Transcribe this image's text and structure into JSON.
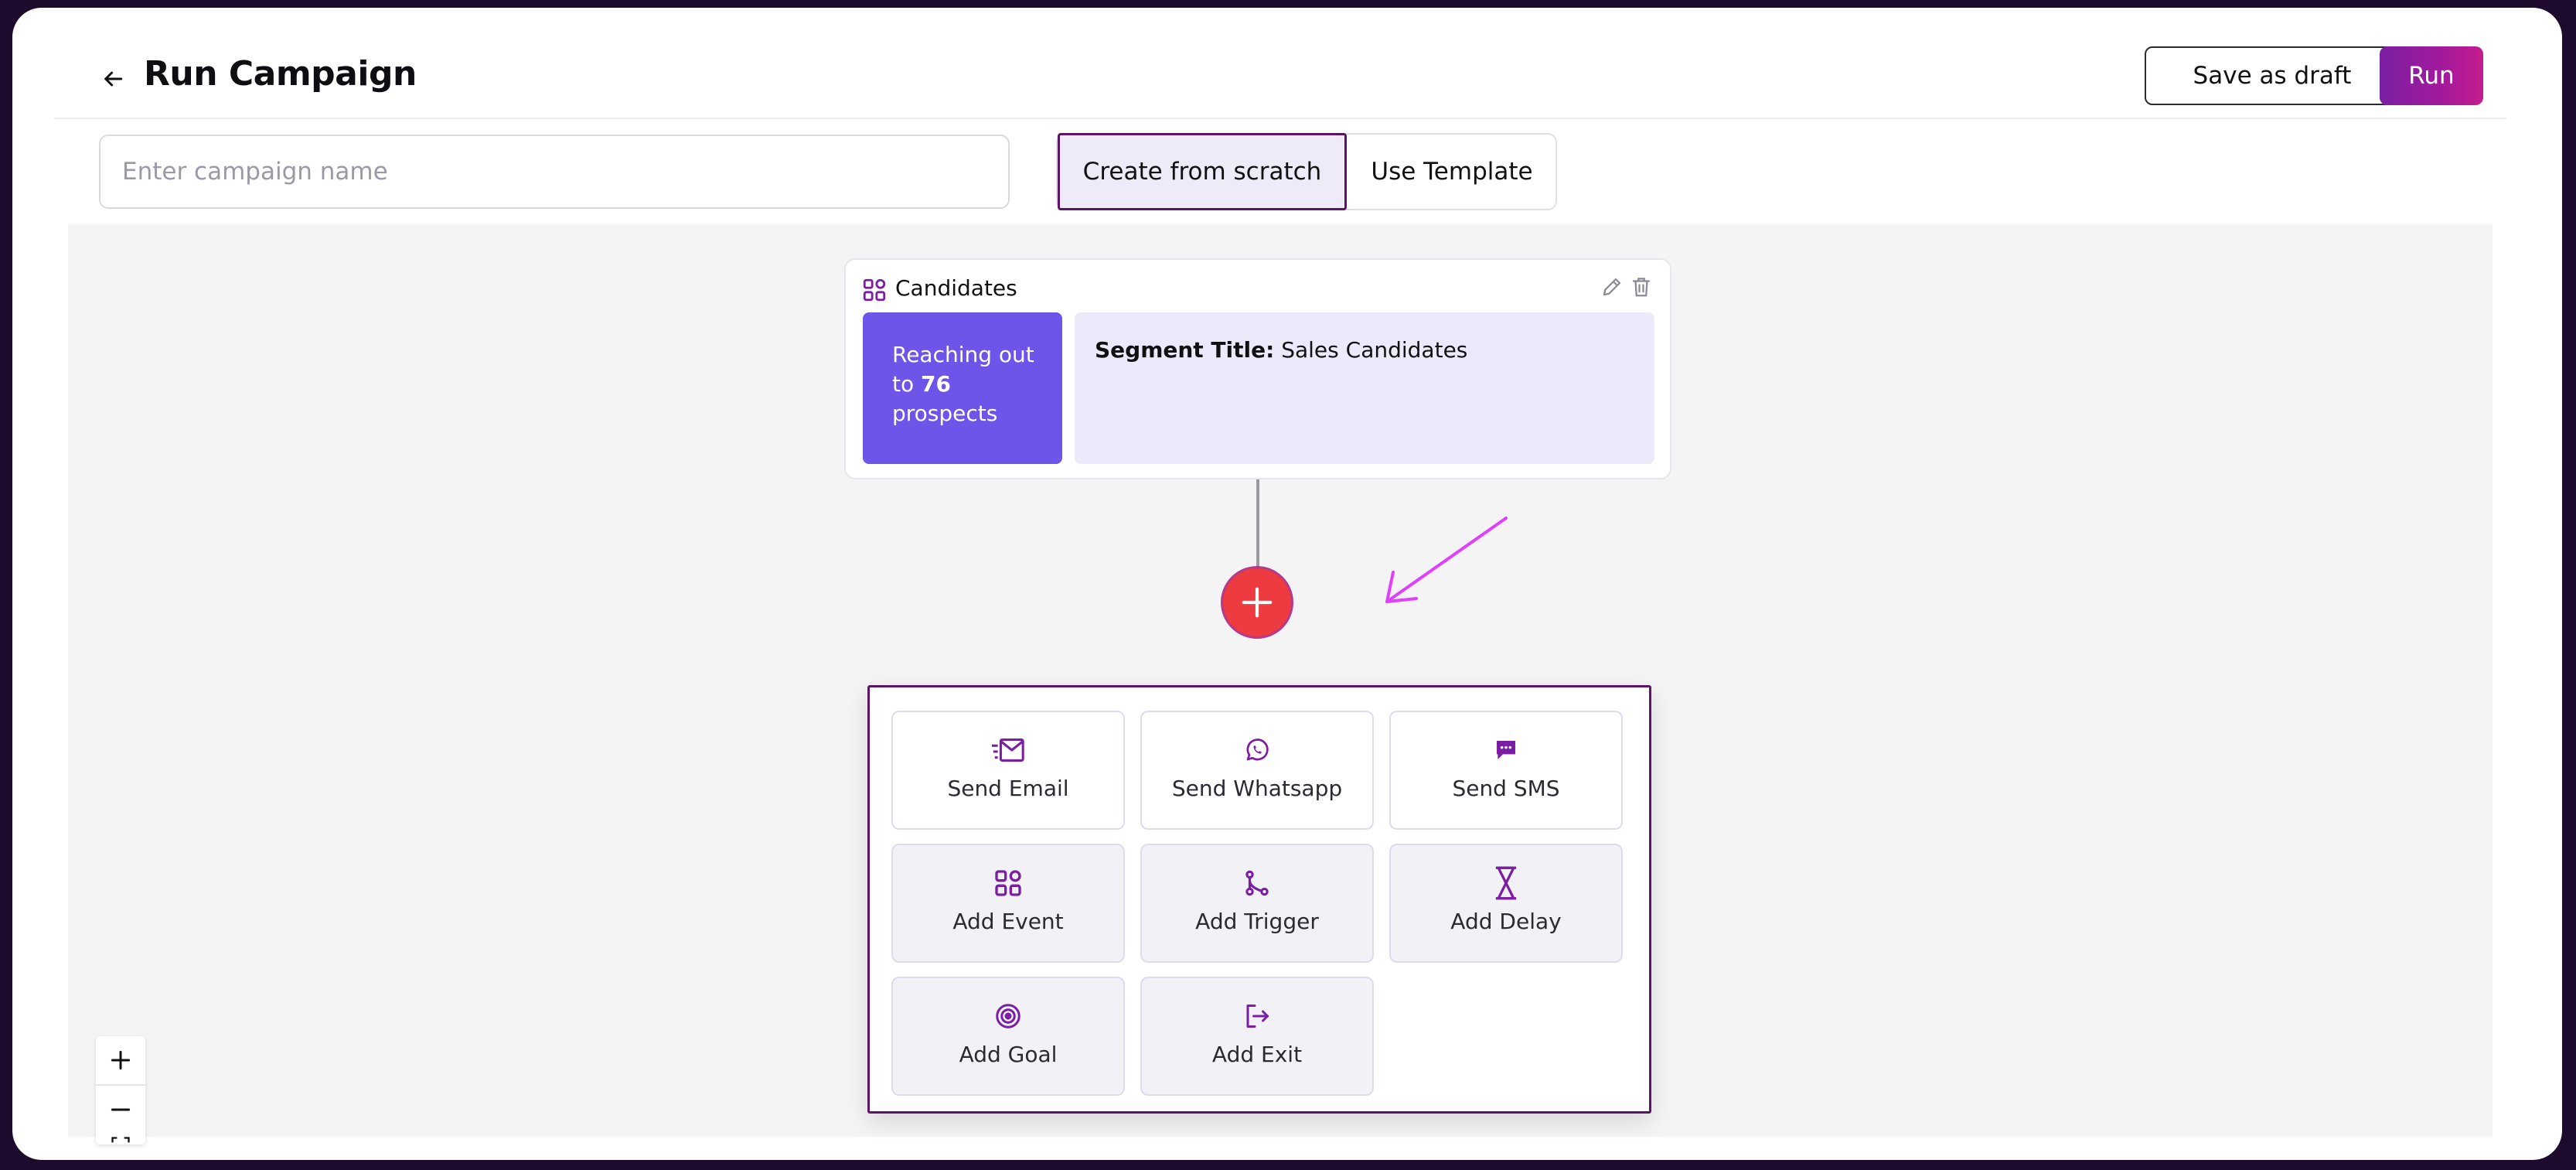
{
  "header": {
    "title": "Run Campaign",
    "save_draft_label": "Save as draft",
    "run_label": "Run"
  },
  "campaign": {
    "name_value": "",
    "name_placeholder": "Enter campaign name"
  },
  "mode_toggle": {
    "options": [
      "Create from scratch",
      "Use Template"
    ],
    "selected": "Create from scratch"
  },
  "node": {
    "title": "Candidates",
    "reach_prefix": "Reaching out to",
    "reach_count": "76",
    "reach_suffix": "prospects",
    "segment_label": "Segment Title:",
    "segment_value": "Sales Candidates"
  },
  "action_menu": {
    "items": [
      {
        "label": "Send Email",
        "icon": "email-icon"
      },
      {
        "label": "Send Whatsapp",
        "icon": "whatsapp-icon"
      },
      {
        "label": "Send SMS",
        "icon": "sms-icon"
      },
      {
        "label": "Add Event",
        "icon": "event-icon"
      },
      {
        "label": "Add Trigger",
        "icon": "trigger-icon"
      },
      {
        "label": "Add Delay",
        "icon": "hourglass-icon"
      },
      {
        "label": "Add Goal",
        "icon": "target-icon"
      },
      {
        "label": "Add Exit",
        "icon": "exit-icon"
      }
    ]
  },
  "colors": {
    "accent": "#7b1fa2",
    "run_gradient_end": "#c51c8e",
    "reach_card": "#6c55e8",
    "segment_card": "#ece9fb",
    "plus_button": "#ee3b3f",
    "annotation_arrow": "#e040fb"
  }
}
